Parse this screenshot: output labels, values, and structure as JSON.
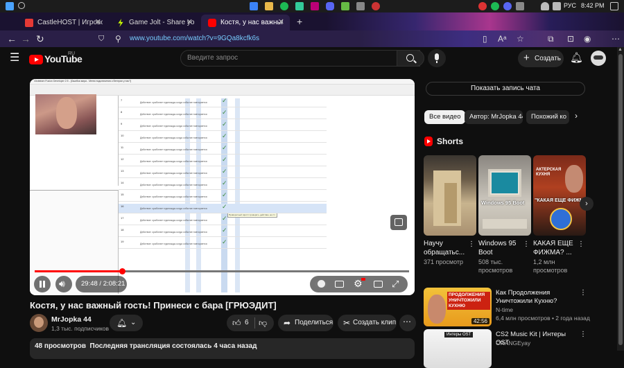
{
  "taskbar": {
    "language": "РУС",
    "time": "8:42 PM"
  },
  "browser": {
    "tabs": [
      {
        "title": "CastleHOST | Игровой хостинг",
        "favicon_color": "#e53935"
      },
      {
        "title": "Game Jolt - Share your creations",
        "favicon_color": "#ccff00"
      },
      {
        "title": "Костя, у нас важный гость",
        "favicon_color": "#ff0000"
      }
    ],
    "url": "www.youtube.com/watch?v=9GQa8kcfk6s"
  },
  "yt_header": {
    "logo": "YouTube",
    "region": "RU",
    "search_placeholder": "Введите запрос",
    "create_label": "Создать"
  },
  "player": {
    "time": "29:48 / 2:08:21",
    "progress_fraction": 0.233,
    "screen_content": {
      "window_title": "Clickteam Fusion Developer 2.5 - [Ошибка мира - Меню подключения к Венгрии у нас?]",
      "tooltip": "Приворотный скрипт проверить действие на 2.1",
      "row_numbers": [
        "7",
        "8",
        "9",
        "10",
        "11",
        "12",
        "13",
        "14",
        "15",
        "16",
        "17",
        "18",
        "19"
      ],
      "row_label": "Действие: сработает единожды когда событие повторяется"
    }
  },
  "video": {
    "title": "Костя, у нас важный гость! Принеси с бара [ГРЮЭДИТ]",
    "channel": "MrJopka 44",
    "subscribers": "1,3 тыс. подписчиков",
    "likes": "6",
    "share_label": "Поделиться",
    "clip_label": "Создать клип",
    "description": "48 просмотров  Последняя трансляция состоялась 4 часа назад"
  },
  "sidebar": {
    "chat_button": "Показать запись чата",
    "chips": [
      "Все видео",
      "Автор: MrJopka 44",
      "Похожий ко"
    ],
    "shorts_heading": "Shorts",
    "shorts": [
      {
        "title": "Научу обращатьс...",
        "meta": "371 просмотр"
      },
      {
        "title": "Windows 95 Boot",
        "meta": "508 тыс. просмотров",
        "thumb_text": "Windows 95 Boot"
      },
      {
        "title": "КАКАЯ ЕЩЕ ФИЖМА? ...",
        "meta": "1,2 млн просмотров",
        "thumb_text": "\"КАКАЯ ЕЩЕ ФИЖМ",
        "thumb_top_text": "АКТЕРСКАЯ КУХНЯ"
      }
    ],
    "videos": [
      {
        "title": "Как Продолжения Уничтожили Кухню?",
        "channel": "N-time",
        "meta": "6,4 млн просмотров • 2 года назад",
        "duration": "42:56",
        "thumb_text": "ПРОДОЛЖЕНИЯ УНИЧТОЖИЛИ КУХНЮ"
      },
      {
        "title": "CS2 Music Kit | Интеры OST",
        "channel": "ORANGEyay",
        "meta": "",
        "thumb_text": "Интеры OST"
      }
    ]
  }
}
